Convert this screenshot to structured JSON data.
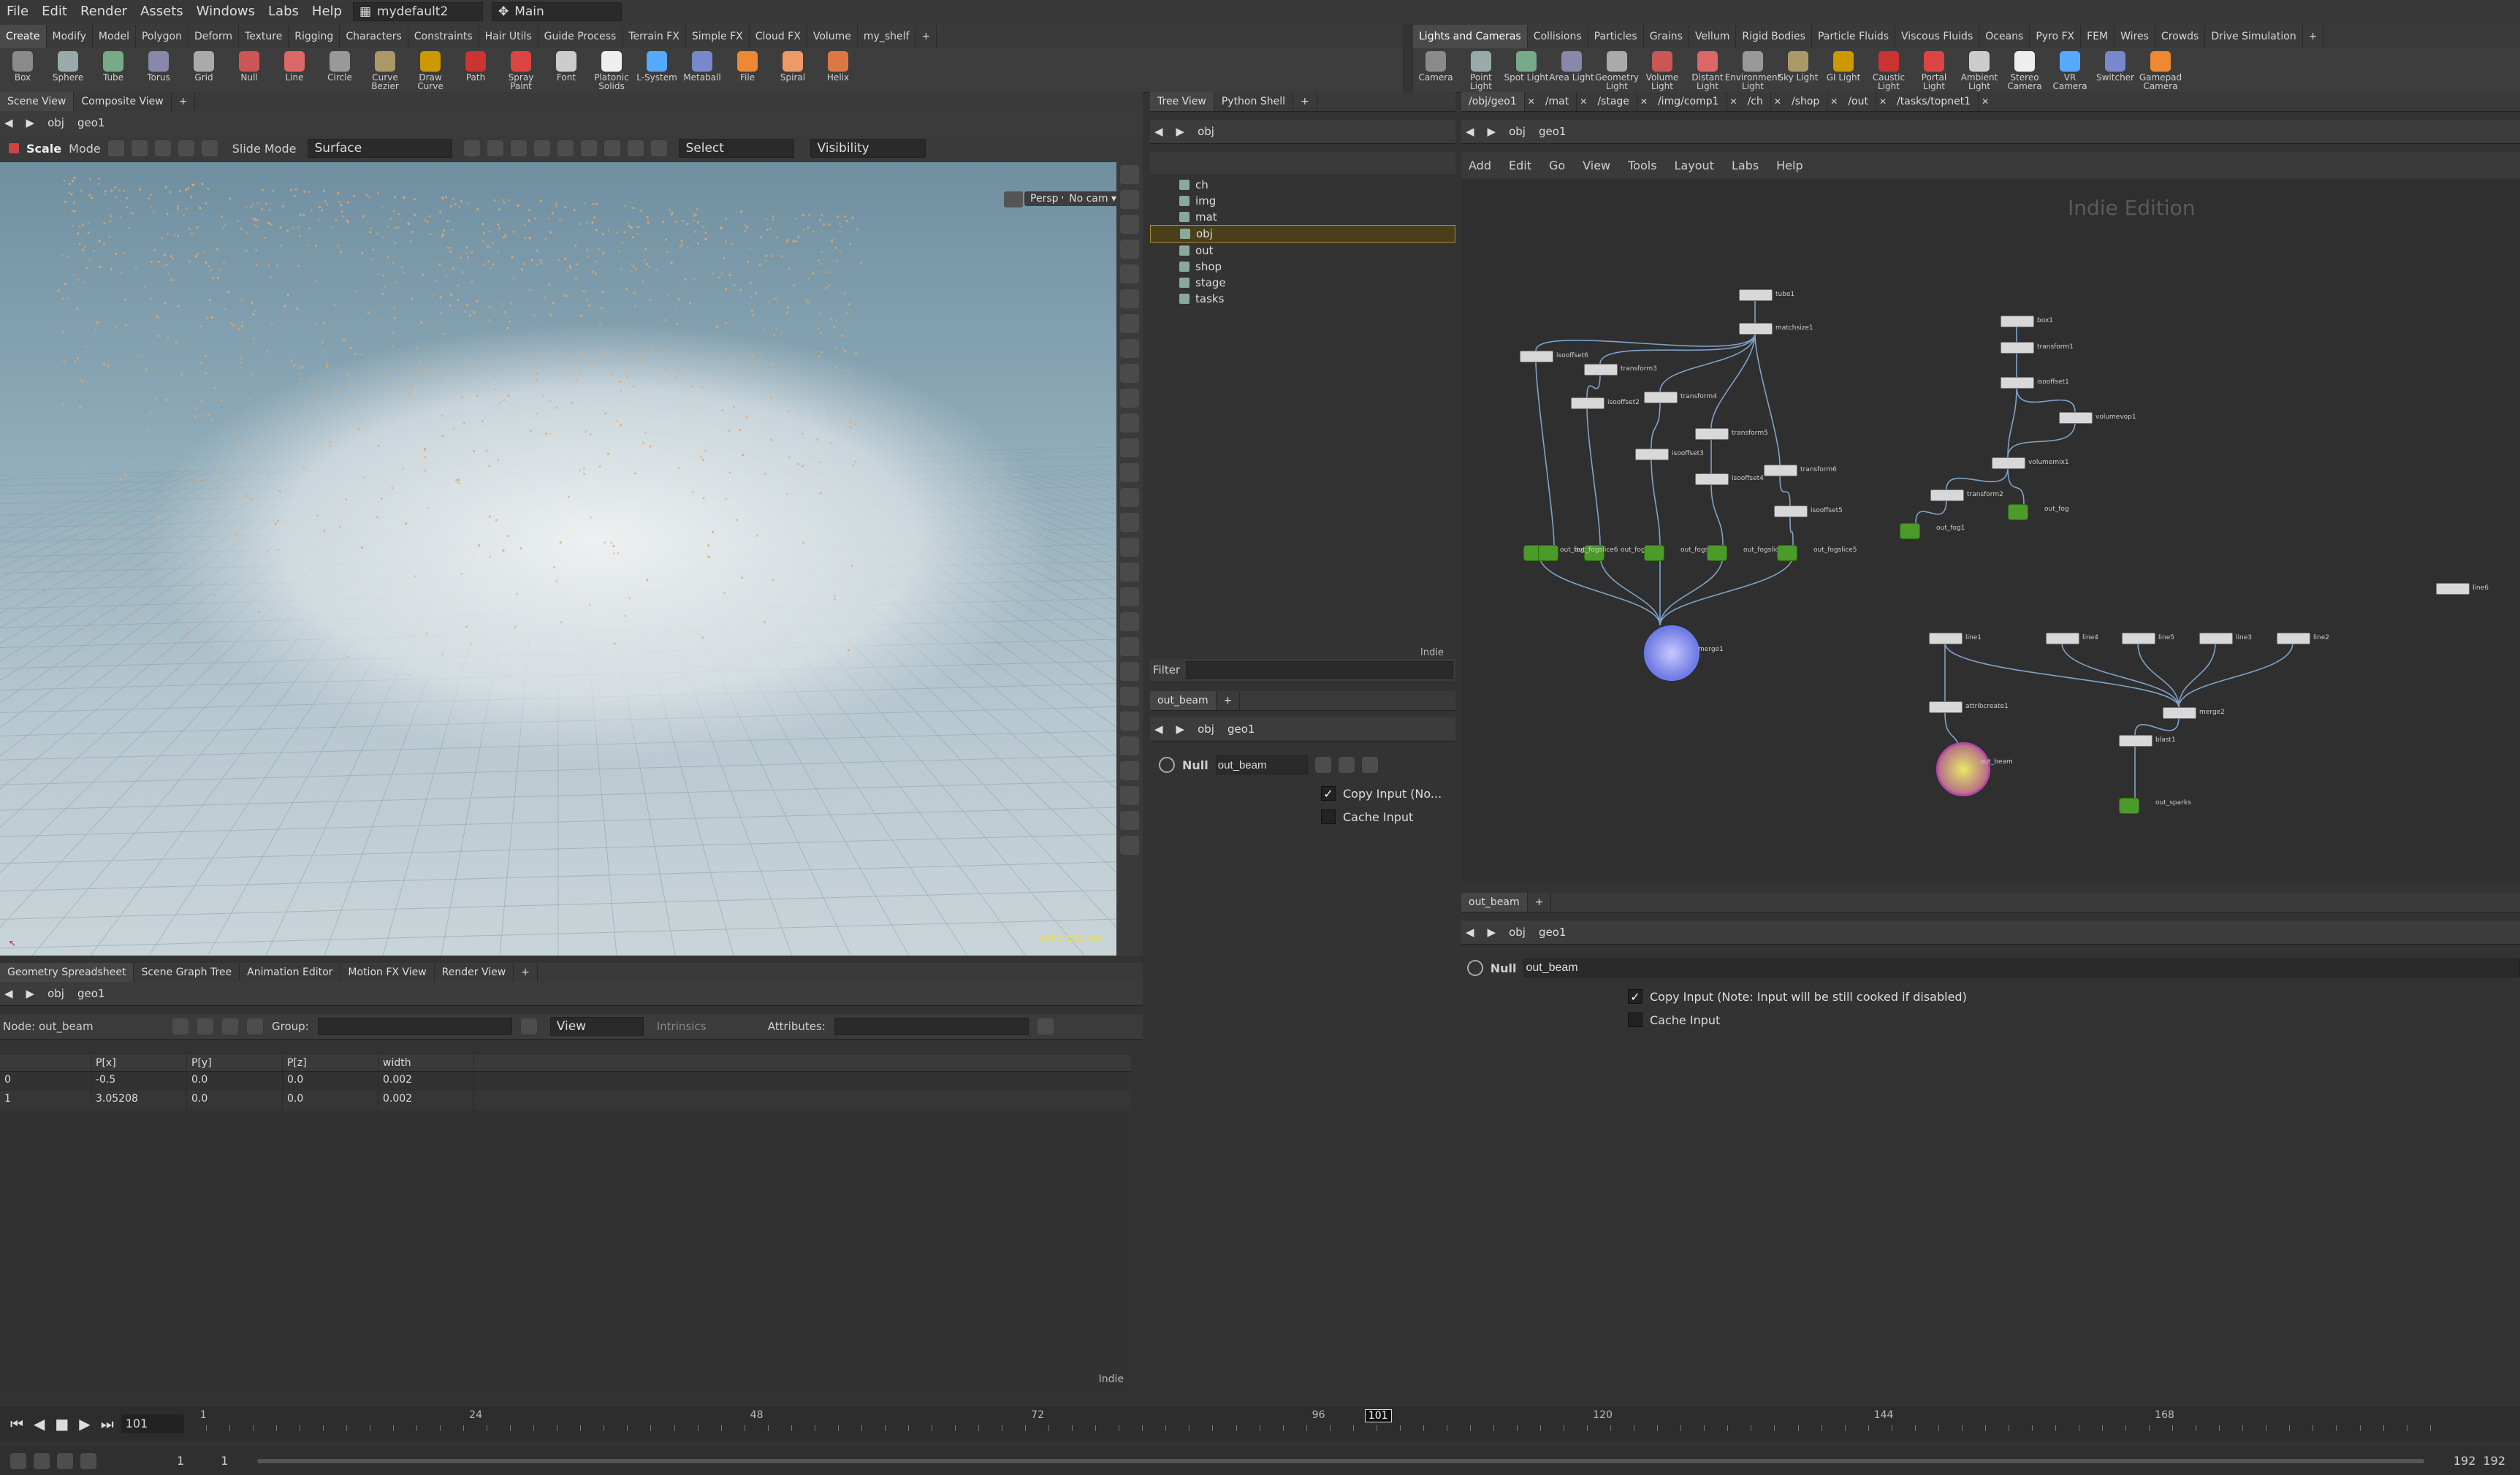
{
  "menu": [
    "File",
    "Edit",
    "Render",
    "Assets",
    "Windows",
    "Labs",
    "Help"
  ],
  "desktop": {
    "scene": "mydefault2",
    "layout": "Main"
  },
  "shelf_left_tabs": [
    "Create",
    "Modify",
    "Model",
    "Polygon",
    "Deform",
    "Texture",
    "Rigging",
    "Characters",
    "Constraints",
    "Hair Utils",
    "Guide Process",
    "Terrain FX",
    "Simple FX",
    "Cloud FX",
    "Volume",
    "my_shelf"
  ],
  "shelf_left_tools": [
    "Box",
    "Sphere",
    "Tube",
    "Torus",
    "Grid",
    "Null",
    "Line",
    "Circle",
    "Curve Bezier",
    "Draw Curve",
    "Path",
    "Spray Paint",
    "Font",
    "Platonic Solids",
    "L-System",
    "Metaball",
    "File",
    "Spiral",
    "Helix"
  ],
  "shelf_right_tabs": [
    "Lights and Cameras",
    "Collisions",
    "Particles",
    "Grains",
    "Vellum",
    "Rigid Bodies",
    "Particle Fluids",
    "Viscous Fluids",
    "Oceans",
    "Pyro FX",
    "FEM",
    "Wires",
    "Crowds",
    "Drive Simulation"
  ],
  "shelf_right_tools": [
    "Camera",
    "Point Light",
    "Spot Light",
    "Area Light",
    "Geometry Light",
    "Volume Light",
    "Distant Light",
    "Environment Light",
    "Sky Light",
    "GI Light",
    "Caustic Light",
    "Portal Light",
    "Ambient Light",
    "Stereo Camera",
    "VR Camera",
    "Switcher",
    "Gamepad Camera"
  ],
  "viewport": {
    "tabs": [
      "Scene View",
      "Composite View"
    ],
    "path": [
      "obj",
      "geo1"
    ],
    "toolbar": {
      "tool": "Scale",
      "mode": "Mode",
      "slide": "Slide Mode",
      "surface": "Surface",
      "select": "Select",
      "visibility": "Visibility"
    },
    "persp": "Persp",
    "cam": "No cam",
    "edition": "Indie Edition"
  },
  "spreadsheet": {
    "tabs": [
      "Geometry Spreadsheet",
      "Scene Graph Tree",
      "Animation Editor",
      "Motion FX View",
      "Render View"
    ],
    "path": [
      "obj",
      "geo1"
    ],
    "group_label": "Group:",
    "view_label": "View",
    "intrinsics": "Intrinsics",
    "attributes_label": "Attributes:",
    "node": "Node: out_beam",
    "columns": [
      "",
      "P[x]",
      "P[y]",
      "P[z]",
      "width"
    ],
    "rows": [
      [
        "0",
        "-0.5",
        "0.0",
        "0.0",
        "0.002"
      ],
      [
        "1",
        "3.05208",
        "0.0",
        "0.0",
        "0.002"
      ]
    ],
    "indie": "Indie"
  },
  "treeview": {
    "tabs": [
      "Tree View",
      "Python Shell"
    ],
    "path": "obj",
    "items": [
      "ch",
      "img",
      "mat",
      "obj",
      "out",
      "shop",
      "stage",
      "tasks"
    ],
    "filter_label": "Filter",
    "indie": "Indie"
  },
  "params_mid": {
    "tab": "out_beam",
    "path": [
      "obj",
      "geo1"
    ],
    "type": "Null",
    "name": "out_beam",
    "copy_input": "Copy Input (No...",
    "cache_input": "Cache Input"
  },
  "network": {
    "path_tabs": [
      "/obj/geo1",
      "/mat",
      "/stage",
      "/img/comp1",
      "/ch",
      "/shop",
      "/out",
      "/tasks/topnet1"
    ],
    "menu": [
      "Add",
      "Edit",
      "Go",
      "View",
      "Tools",
      "Layout",
      "Labs",
      "Help"
    ],
    "path": [
      "obj",
      "geo1"
    ],
    "watermark": "Indie Edition",
    "nodes": [
      "tube1",
      "matchsize1",
      "isooffset6",
      "transform3",
      "transform4",
      "isooffset2",
      "transform5",
      "isooffset3",
      "isooffset4",
      "transform6",
      "isooffset5",
      "out_fogslice1",
      "out_fogslice2",
      "out_fogslice3",
      "out_fogslice4",
      "out_fogslice5",
      "out_fogslice6",
      "merge1",
      "box1",
      "transform1",
      "isooffset1",
      "volumevop1",
      "volumemix1",
      "transform2",
      "out_fog1",
      "out_fog",
      "line1",
      "line4",
      "line5",
      "line3",
      "line2",
      "attribcreate1",
      "merge2",
      "out_beam",
      "blast1",
      "out_sparks",
      "line6"
    ]
  },
  "params_right": {
    "tab": "out_beam",
    "path": [
      "obj",
      "geo1"
    ],
    "type": "Null",
    "name": "out_beam",
    "copy_input": "Copy Input (Note: Input will be still cooked if disabled)",
    "cache_input": "Cache Input"
  },
  "timeline": {
    "frame": "101",
    "ticks": [
      "1",
      "24",
      "48",
      "72",
      "96",
      "120",
      "144",
      "168"
    ],
    "marker": "101",
    "start": "1",
    "start2": "1",
    "end": "192",
    "end2": "192"
  }
}
